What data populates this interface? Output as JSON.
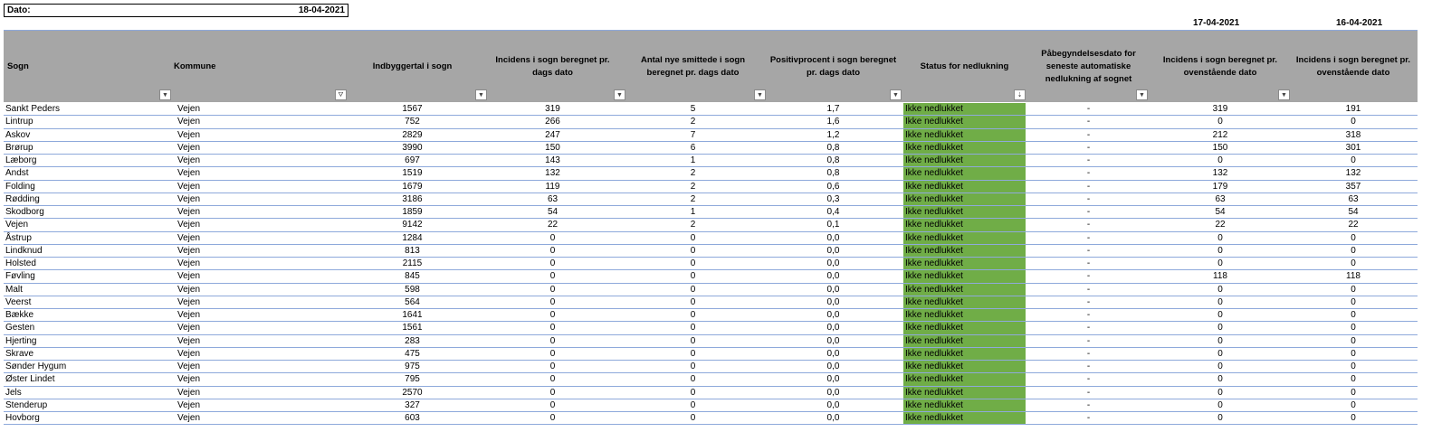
{
  "date_label": "Dato:",
  "date_value": "18-04-2021",
  "prev_dates": [
    "17-04-2021",
    "16-04-2021"
  ],
  "colors": {
    "header_bg": "#a6a6a6",
    "status_green": "#70ad47",
    "row_border": "#8ea9db"
  },
  "columns": [
    {
      "label": "Sogn",
      "align": "left"
    },
    {
      "label": "Kommune",
      "align": "left"
    },
    {
      "label": "Indbyggertal i sogn",
      "align": "center"
    },
    {
      "label": "Incidens i sogn beregnet pr. dags dato",
      "align": "center"
    },
    {
      "label": "Antal nye smittede i sogn beregnet pr. dags dato",
      "align": "center"
    },
    {
      "label": "Positivprocent i sogn beregnet pr. dags dato",
      "align": "center"
    },
    {
      "label": "Status for nedlukning",
      "align": "center"
    },
    {
      "label": "Påbegyndelsesdato for seneste automatiske nedlukning af sognet",
      "align": "center"
    },
    {
      "label": "Incidens i sogn beregnet pr. ovenstående dato",
      "align": "center"
    },
    {
      "label": "Incidens i sogn beregnet pr. ovenstående dato",
      "align": "center"
    }
  ],
  "filter_icons": [
    "dropdown-arrow-icon",
    "filter-applied-icon",
    "dropdown-arrow-icon",
    "dropdown-arrow-icon",
    "dropdown-arrow-icon",
    "dropdown-arrow-icon",
    "sort-filter-icon",
    "dropdown-arrow-icon",
    "dropdown-arrow-icon"
  ],
  "rows": [
    [
      "Sankt Peders",
      "Vejen",
      "1567",
      "319",
      "5",
      "1,7",
      "Ikke nedlukket",
      "-",
      "319",
      "191"
    ],
    [
      "Lintrup",
      "Vejen",
      "752",
      "266",
      "2",
      "1,6",
      "Ikke nedlukket",
      "-",
      "0",
      "0"
    ],
    [
      "Askov",
      "Vejen",
      "2829",
      "247",
      "7",
      "1,2",
      "Ikke nedlukket",
      "-",
      "212",
      "318"
    ],
    [
      "Brørup",
      "Vejen",
      "3990",
      "150",
      "6",
      "0,8",
      "Ikke nedlukket",
      "-",
      "150",
      "301"
    ],
    [
      "Læborg",
      "Vejen",
      "697",
      "143",
      "1",
      "0,8",
      "Ikke nedlukket",
      "-",
      "0",
      "0"
    ],
    [
      "Andst",
      "Vejen",
      "1519",
      "132",
      "2",
      "0,8",
      "Ikke nedlukket",
      "-",
      "132",
      "132"
    ],
    [
      "Folding",
      "Vejen",
      "1679",
      "119",
      "2",
      "0,6",
      "Ikke nedlukket",
      "-",
      "179",
      "357"
    ],
    [
      "Rødding",
      "Vejen",
      "3186",
      "63",
      "2",
      "0,3",
      "Ikke nedlukket",
      "-",
      "63",
      "63"
    ],
    [
      "Skodborg",
      "Vejen",
      "1859",
      "54",
      "1",
      "0,4",
      "Ikke nedlukket",
      "-",
      "54",
      "54"
    ],
    [
      "Vejen",
      "Vejen",
      "9142",
      "22",
      "2",
      "0,1",
      "Ikke nedlukket",
      "-",
      "22",
      "22"
    ],
    [
      "Åstrup",
      "Vejen",
      "1284",
      "0",
      "0",
      "0,0",
      "Ikke nedlukket",
      "-",
      "0",
      "0"
    ],
    [
      "Lindknud",
      "Vejen",
      "813",
      "0",
      "0",
      "0,0",
      "Ikke nedlukket",
      "-",
      "0",
      "0"
    ],
    [
      "Holsted",
      "Vejen",
      "2115",
      "0",
      "0",
      "0,0",
      "Ikke nedlukket",
      "-",
      "0",
      "0"
    ],
    [
      "Føvling",
      "Vejen",
      "845",
      "0",
      "0",
      "0,0",
      "Ikke nedlukket",
      "-",
      "118",
      "118"
    ],
    [
      "Malt",
      "Vejen",
      "598",
      "0",
      "0",
      "0,0",
      "Ikke nedlukket",
      "-",
      "0",
      "0"
    ],
    [
      "Veerst",
      "Vejen",
      "564",
      "0",
      "0",
      "0,0",
      "Ikke nedlukket",
      "-",
      "0",
      "0"
    ],
    [
      "Bække",
      "Vejen",
      "1641",
      "0",
      "0",
      "0,0",
      "Ikke nedlukket",
      "-",
      "0",
      "0"
    ],
    [
      "Gesten",
      "Vejen",
      "1561",
      "0",
      "0",
      "0,0",
      "Ikke nedlukket",
      "-",
      "0",
      "0"
    ],
    [
      "Hjerting",
      "Vejen",
      "283",
      "0",
      "0",
      "0,0",
      "Ikke nedlukket",
      "-",
      "0",
      "0"
    ],
    [
      "Skrave",
      "Vejen",
      "475",
      "0",
      "0",
      "0,0",
      "Ikke nedlukket",
      "-",
      "0",
      "0"
    ],
    [
      "Sønder Hygum",
      "Vejen",
      "975",
      "0",
      "0",
      "0,0",
      "Ikke nedlukket",
      "-",
      "0",
      "0"
    ],
    [
      "Øster Lindet",
      "Vejen",
      "795",
      "0",
      "0",
      "0,0",
      "Ikke nedlukket",
      "-",
      "0",
      "0"
    ],
    [
      "Jels",
      "Vejen",
      "2570",
      "0",
      "0",
      "0,0",
      "Ikke nedlukket",
      "-",
      "0",
      "0"
    ],
    [
      "Stenderup",
      "Vejen",
      "327",
      "0",
      "0",
      "0,0",
      "Ikke nedlukket",
      "-",
      "0",
      "0"
    ],
    [
      "Hovborg",
      "Vejen",
      "603",
      "0",
      "0",
      "0,0",
      "Ikke nedlukket",
      "-",
      "0",
      "0"
    ]
  ]
}
